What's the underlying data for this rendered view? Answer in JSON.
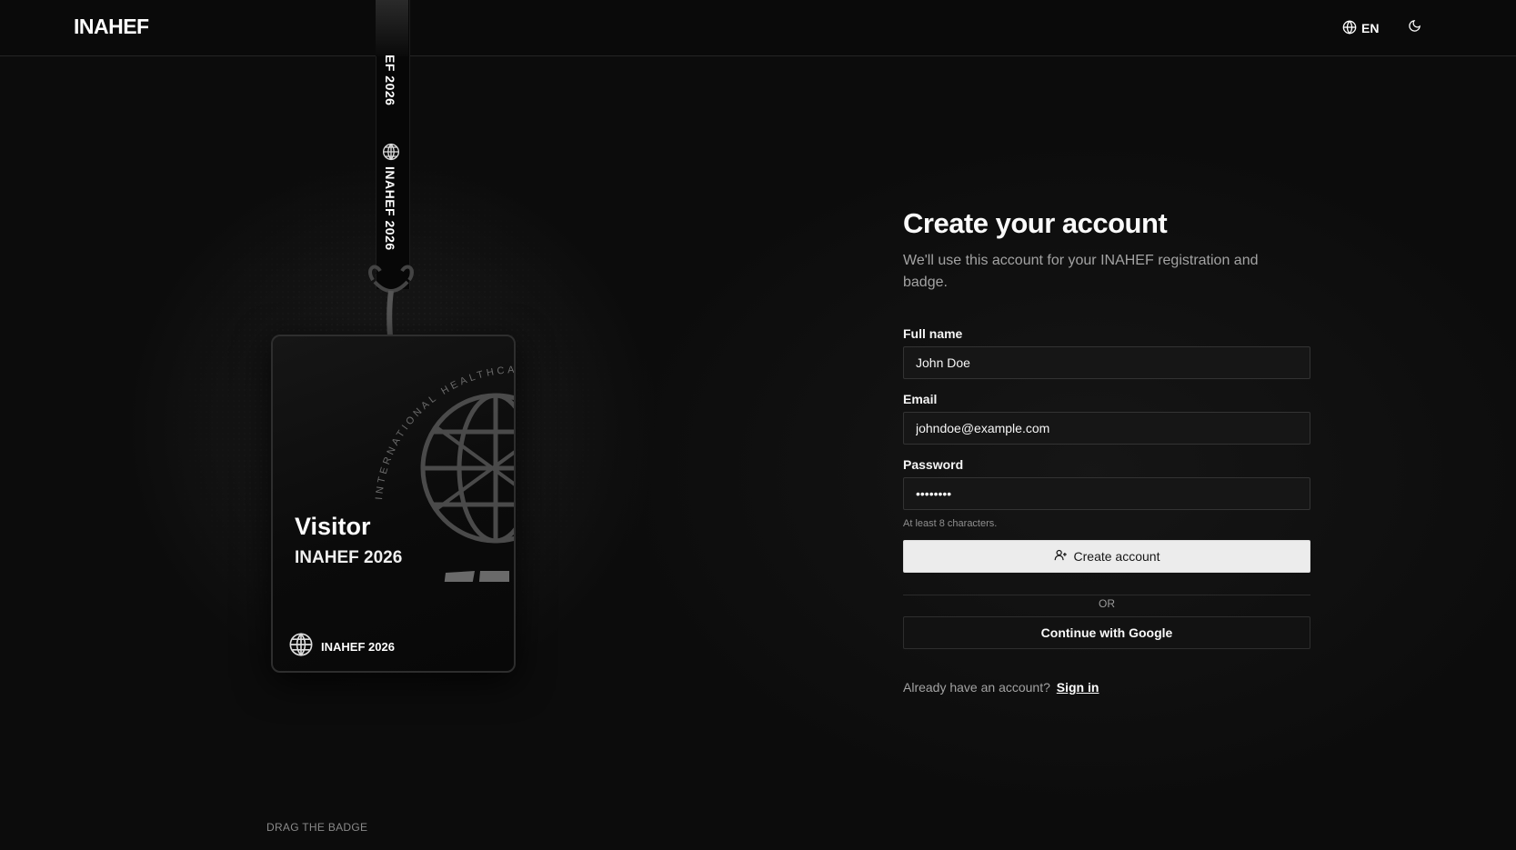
{
  "header": {
    "logo": "INAHEF",
    "language": "EN",
    "icons": {
      "language": "globe-icon",
      "theme": "moon-icon"
    }
  },
  "lanyard": {
    "text_top": "EF 2026",
    "text_main": "INAHEF 2026"
  },
  "badge": {
    "title": "Visitor",
    "subtitle": "INAHEF 2026",
    "arc_text": "INTERNATIONAL HEALTHCARE ENGINEER",
    "footer": "INAHEF 2026"
  },
  "drag_hint": "DRAG THE BADGE",
  "form": {
    "title": "Create your account",
    "subtitle": "We'll use this account for your INAHEF registration and badge.",
    "full_name": {
      "label": "Full name",
      "value": "John Doe"
    },
    "email": {
      "label": "Email",
      "value": "johndoe@example.com"
    },
    "password": {
      "label": "Password",
      "value": "••••••••",
      "hint": "At least 8 characters."
    },
    "submit_label": "Create account",
    "divider": "OR",
    "google_label": "Continue with Google",
    "signin_prompt": "Already have an account?",
    "signin_link": "Sign in"
  },
  "colors": {
    "background": "#0c0c0c",
    "primary_button": "#ececec",
    "input_bg": "#161616"
  }
}
